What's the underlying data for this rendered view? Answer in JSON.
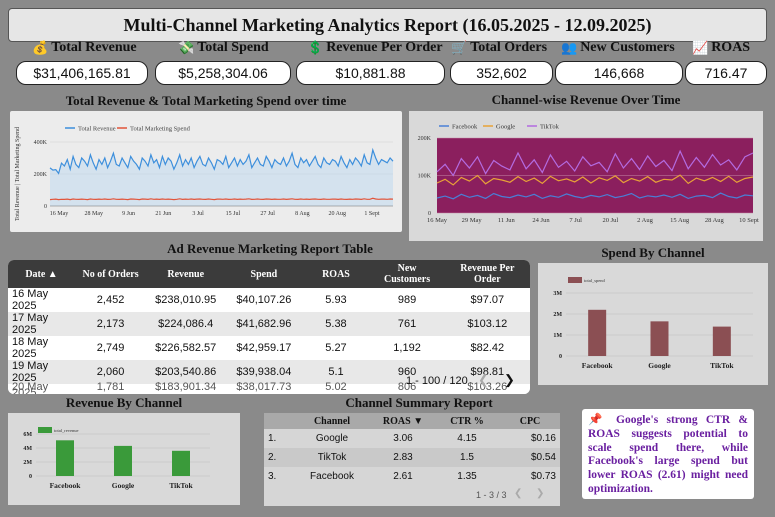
{
  "header": {
    "title": "Multi-Channel Marketing Analytics Report (16.05.2025 - 12.09.2025)"
  },
  "kpis": [
    {
      "icon": "💰",
      "icon_name": "money-bag-icon",
      "label": "Total Revenue",
      "value": "$31,406,165.81"
    },
    {
      "icon": "💸",
      "icon_name": "money-wings-icon",
      "label": "Total Spend",
      "value": "$5,258,304.06"
    },
    {
      "icon": "💲",
      "icon_name": "dollar-icon",
      "label": "Revenue Per Order",
      "value": "$10,881.88"
    },
    {
      "icon": "🛒",
      "icon_name": "cart-icon",
      "label": "Total Orders",
      "value": "352,602"
    },
    {
      "icon": "👥",
      "icon_name": "users-icon",
      "label": "New Customers",
      "value": "146,668"
    },
    {
      "icon": "📈",
      "icon_name": "chart-up-icon",
      "label": "ROAS",
      "value": "716.47"
    }
  ],
  "sections": {
    "revenue_spend_title": "Total Revenue & Total Marketing Spend over time",
    "channel_revenue_title": "Channel-wise Revenue Over Time",
    "table_title": "Ad Revenue Marketing Report Table",
    "spend_channel_title": "Spend By Channel",
    "revenue_channel_title": "Revenue By Channel",
    "summary_title": "Channel Summary Report"
  },
  "colors": {
    "revenue": "#3d8fdc",
    "spend": "#e2543a",
    "facebook": "#4a7fd6",
    "google": "#e8a238",
    "tiktok": "#b36be0",
    "bar_spend": "#8b4f53",
    "bar_revenue": "#3a9a3a",
    "plot_bg": "#8b1f5e",
    "note_text": "#6a1fa0"
  },
  "chart_data": [
    {
      "type": "line",
      "title": "Total Revenue & Total Marketing Spend over time",
      "ylabel": "Total Revenue | Total Marketing Spend",
      "x_ticks": [
        "16 May",
        "28 May",
        "9 Jun",
        "21 Jun",
        "3 Jul",
        "15 Jul",
        "27 Jul",
        "8 Aug",
        "20 Aug",
        "1 Sept"
      ],
      "y_ticks": [
        "0",
        "200K",
        "400K"
      ],
      "ylim": [
        0,
        400000
      ],
      "legend_position": "top-left",
      "series": [
        {
          "name": "Total Revenue",
          "values": [
            238010,
            224086,
            226582,
            203540,
            268000,
            250000,
            290000,
            230000,
            310000,
            260000,
            240000,
            300000,
            280000,
            250000,
            320000,
            270000,
            230000,
            290000,
            260000,
            300000,
            240000,
            280000,
            330000,
            260000,
            250000,
            300000,
            270000,
            240000,
            310000,
            280000,
            260000,
            230000,
            300000,
            280000,
            250000,
            320000,
            270000,
            290000,
            240000,
            310000,
            260000,
            300000,
            280000,
            230000,
            270000,
            320000,
            250000,
            290000,
            260000,
            300000,
            240000,
            280000,
            310000,
            260000,
            250000,
            300000,
            270000,
            230000,
            290000,
            280000,
            260000,
            310000,
            240000,
            270000,
            300000,
            250000,
            290000,
            260000,
            280000,
            320000,
            240000,
            270000,
            300000,
            260000,
            250000,
            310000,
            280000,
            240000,
            290000,
            270000,
            260000,
            300000,
            250000,
            280000,
            330000,
            260000,
            240000,
            300000,
            270000,
            290000,
            250000,
            280000,
            310000,
            260000,
            240000,
            300000,
            270000,
            260000,
            290000,
            280000,
            250000,
            310000,
            270000,
            240000,
            290000,
            260000,
            300000,
            280000,
            250000,
            320000,
            270000,
            260000,
            350000,
            300000,
            260000,
            290000,
            280000,
            270000,
            300000,
            280000
          ]
        },
        {
          "name": "Total Marketing Spend",
          "values": [
            40107,
            41683,
            42959,
            39938,
            42000,
            41000,
            43000,
            40000,
            44000,
            42000,
            41000,
            43000,
            42000,
            40000,
            44000,
            42000,
            41000,
            43000,
            42000,
            44000,
            41000,
            42000,
            45000,
            42000,
            41000,
            43000,
            42000,
            40000,
            44000,
            43000,
            42000,
            40000,
            44000,
            43000,
            41000,
            45000,
            42000,
            43000,
            41000,
            44000,
            42000,
            43000,
            42000,
            40000,
            42000,
            45000,
            41000,
            43000,
            42000,
            44000,
            41000,
            43000,
            44000,
            42000,
            41000,
            44000,
            42000,
            40000,
            43000,
            43000,
            42000,
            44000,
            41000,
            42000,
            44000,
            41000,
            43000,
            42000,
            43000,
            45000,
            41000,
            42000,
            44000,
            42000,
            41000,
            44000,
            43000,
            41000,
            43000,
            42000,
            42000,
            44000,
            41000,
            43000,
            45000,
            42000,
            41000,
            44000,
            42000,
            43000,
            41000,
            43000,
            44000,
            42000,
            41000,
            44000,
            42000,
            42000,
            43000,
            43000,
            41000,
            44000,
            42000,
            41000,
            43000,
            42000,
            44000,
            43000,
            41000,
            45000,
            42000,
            42000,
            48000,
            44000,
            42000,
            43000,
            43000,
            42000,
            44000,
            43000
          ]
        }
      ]
    },
    {
      "type": "line",
      "title": "Channel-wise Revenue Over Time",
      "x_ticks": [
        "16 May",
        "29 May",
        "11 Jun",
        "24 Jun",
        "7 Jul",
        "20 Jul",
        "2 Aug",
        "15 Aug",
        "28 Aug",
        "10 Sept"
      ],
      "y_ticks": [
        "0",
        "100K",
        "200K"
      ],
      "ylim": [
        0,
        200000
      ],
      "legend_position": "top-left",
      "series": [
        {
          "name": "Facebook",
          "values": [
            40000,
            45000,
            38000,
            50000,
            42000,
            47000,
            39000,
            52000,
            44000,
            41000,
            48000,
            43000,
            50000,
            39000,
            46000,
            42000,
            51000,
            44000,
            40000,
            47000,
            43000,
            49000,
            41000,
            45000,
            52000,
            40000,
            46000,
            43000,
            48000,
            42000,
            50000,
            39000,
            45000,
            47000,
            41000,
            53000,
            44000,
            40000,
            48000,
            46000
          ]
        },
        {
          "name": "Google",
          "values": [
            80000,
            90000,
            75000,
            95000,
            85000,
            100000,
            78000,
            92000,
            88000,
            82000,
            97000,
            84000,
            93000,
            79000,
            98000,
            86000,
            91000,
            83000,
            96000,
            80000,
            94000,
            87000,
            99000,
            81000,
            92000,
            85000,
            97000,
            82000,
            90000,
            88000,
            101000,
            79000,
            93000,
            86000,
            95000,
            84000,
            98000,
            82000,
            92000,
            96000
          ]
        },
        {
          "name": "TikTok",
          "values": [
            110000,
            130000,
            100000,
            145000,
            120000,
            150000,
            105000,
            140000,
            125000,
            115000,
            160000,
            118000,
            142000,
            108000,
            155000,
            122000,
            138000,
            112000,
            150000,
            126000,
            135000,
            110000,
            158000,
            120000,
            145000,
            116000,
            152000,
            124000,
            140000,
            113000,
            165000,
            118000,
            148000,
            122000,
            156000,
            128000,
            142000,
            115000,
            150000,
            160000
          ]
        }
      ]
    },
    {
      "type": "bar",
      "title": "Spend By Channel",
      "categories": [
        "Facebook",
        "Google",
        "TikTok"
      ],
      "series": [
        {
          "name": "total_spend",
          "values": [
            2200000,
            1650000,
            1400000
          ]
        }
      ],
      "y_ticks": [
        "0",
        "1M",
        "2M",
        "3M"
      ],
      "ylim": [
        0,
        3000000
      ],
      "legend_position": "top-left"
    },
    {
      "type": "bar",
      "title": "Revenue By Channel",
      "categories": [
        "Facebook",
        "Google",
        "TikTok"
      ],
      "series": [
        {
          "name": "total_revenue",
          "values": [
            5100000,
            4300000,
            3600000
          ]
        }
      ],
      "y_ticks": [
        "0",
        "2M",
        "4M",
        "6M"
      ],
      "ylim": [
        0,
        7000000
      ],
      "legend_position": "top-left"
    }
  ],
  "report_table": {
    "headers": [
      {
        "l1": "Date ▲",
        "l2": ""
      },
      {
        "l1": "No of Orders",
        "l2": ""
      },
      {
        "l1": "Revenue",
        "l2": ""
      },
      {
        "l1": "Spend",
        "l2": ""
      },
      {
        "l1": "ROAS",
        "l2": ""
      },
      {
        "l1": "New",
        "l2": "Customers"
      },
      {
        "l1": "Revenue Per",
        "l2": "Order"
      }
    ],
    "rows": [
      [
        "16 May 2025",
        "2,452",
        "$238,010.95",
        "$40,107.26",
        "5.93",
        "989",
        "$97.07"
      ],
      [
        "17 May 2025",
        "2,173",
        "$224,086.4",
        "$41,682.96",
        "5.38",
        "761",
        "$103.12"
      ],
      [
        "18 May 2025",
        "2,749",
        "$226,582.57",
        "$42,959.17",
        "5.27",
        "1,192",
        "$82.42"
      ],
      [
        "19 May 2025",
        "2,060",
        "$203,540.86",
        "$39,938.04",
        "5.1",
        "960",
        "$98.81"
      ],
      [
        "20 May 2025",
        "1,781",
        "$183,901.34",
        "$38,017.73",
        "5.02",
        "806",
        "$103.26"
      ]
    ],
    "pagination": "1 - 100 / 120",
    "prev": "❮",
    "next": "❯"
  },
  "summary_table": {
    "headers": [
      "",
      "Channel",
      "ROAS ▼",
      "CTR %",
      "CPC"
    ],
    "rows": [
      [
        "1.",
        "Google",
        "3.06",
        "4.15",
        "$0.16"
      ],
      [
        "2.",
        "TikTok",
        "2.83",
        "1.5",
        "$0.54"
      ],
      [
        "3.",
        "Facebook",
        "2.61",
        "1.35",
        "$0.73"
      ]
    ],
    "pagination": "1 - 3 / 3",
    "prev": "❮",
    "next": "❯"
  },
  "note": {
    "icon": "📌",
    "text": "Google's strong CTR & ROAS suggests potential to scale spend there, while Facebook's large spend but lower ROAS (2.61) might need optimization."
  }
}
